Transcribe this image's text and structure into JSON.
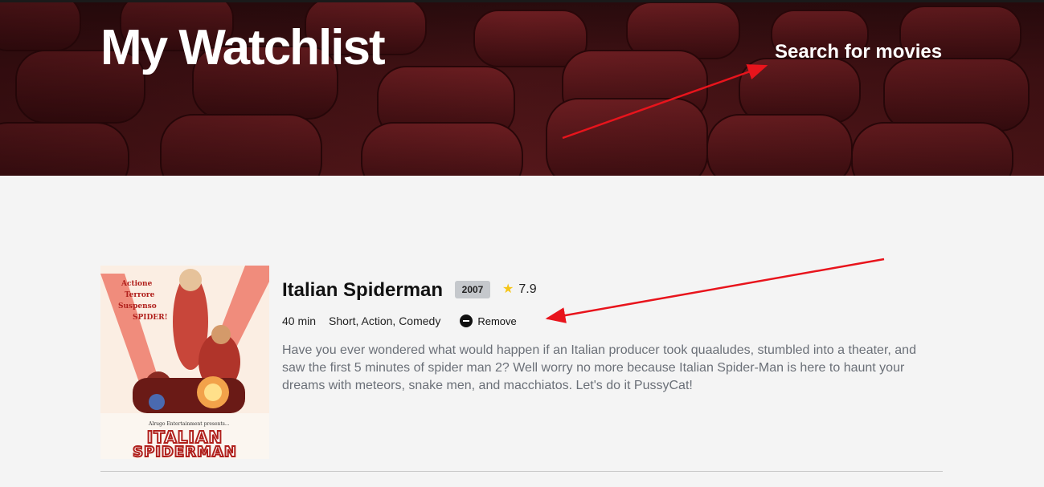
{
  "header": {
    "title": "My Watchlist",
    "search_link": "Search for movies"
  },
  "movie": {
    "title": "Italian Spiderman",
    "year": "2007",
    "rating": "7.9",
    "runtime": "40 min",
    "genres": "Short, Action, Comedy",
    "remove_label": "Remove",
    "plot": "Have you ever wondered what would happen if an Italian producer took quaaludes, stumbled into a theater, and saw the first 5 minutes of spider man 2? Well worry no more because Italian Spider-Man is here to haunt your dreams with meteors, snake men, and macchiatos. Let's do it PussyCat!",
    "poster": {
      "tagline_1": "Actione",
      "tagline_2": "Terrore",
      "tagline_3": "Suspenso",
      "tagline_4": "SPIDER!",
      "presents": "Alrugo Entertainment presents...",
      "title_line_1": "ITALIAN",
      "title_line_2": "SPIDERMAN"
    }
  },
  "icons": {
    "rating": "star-icon",
    "remove": "minus-circle-icon"
  },
  "colors": {
    "hero": "#4a1417",
    "star": "#f5c518",
    "annotation_arrow": "#e8141c",
    "badge": "#c5c8cc"
  }
}
